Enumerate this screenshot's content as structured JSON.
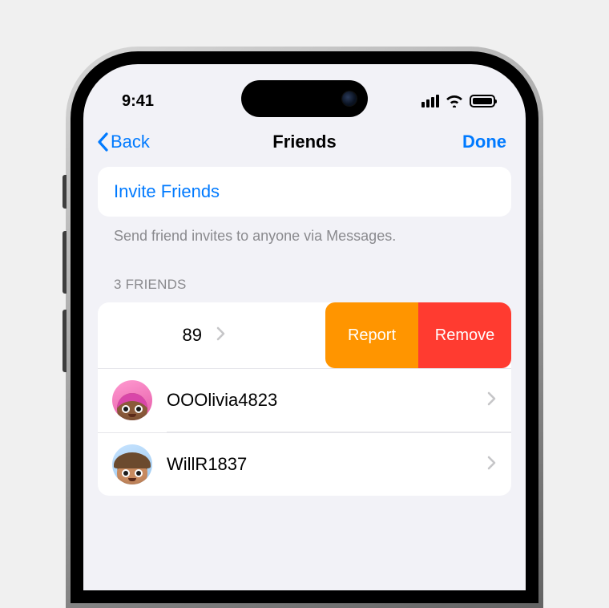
{
  "status": {
    "time": "9:41"
  },
  "nav": {
    "back_label": "Back",
    "title": "Friends",
    "done_label": "Done"
  },
  "invite": {
    "label": "Invite Friends",
    "helper": "Send friend invites to anyone via Messages."
  },
  "friends": {
    "header": "3 FRIENDS",
    "swiped": {
      "name_fragment": "89",
      "report_label": "Report",
      "remove_label": "Remove"
    },
    "list": [
      {
        "name": "OOOlivia4823",
        "avatar_style": "pink"
      },
      {
        "name": "WillR1837",
        "avatar_style": "blue"
      }
    ]
  }
}
